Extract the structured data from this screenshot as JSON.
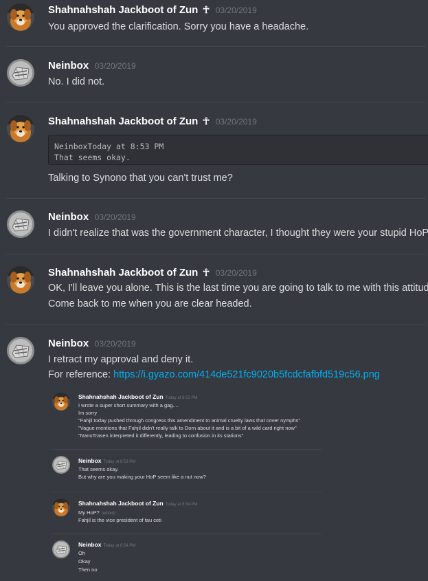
{
  "messages": [
    {
      "author": "Shahnahshah Jackboot of Zun",
      "badge": "☥",
      "timestamp": "03/20/2019",
      "lines": [
        "You approved the clarification. Sorry you have a headache."
      ]
    },
    {
      "author": "Neinbox",
      "timestamp": "03/20/2019",
      "lines": [
        "No. I did not."
      ]
    },
    {
      "author": "Shahnahshah Jackboot of Zun",
      "badge": "☥",
      "timestamp": "03/20/2019",
      "code_lines": [
        "NeinboxToday at 8:53 PM",
        "That seems okay."
      ],
      "lines": [
        "Talking to Synono that you can't trust me?"
      ]
    },
    {
      "author": "Neinbox",
      "timestamp": "03/20/2019",
      "lines": [
        "I didn't realize that was the government character, I thought they were your stupid HoP"
      ]
    },
    {
      "author": "Shahnahshah Jackboot of Zun",
      "badge": "☥",
      "timestamp": "03/20/2019",
      "lines": [
        "OK, I'll leave you alone. This is the last time you are going to talk to me with this attitude.",
        "Come back to me when you are clear headed."
      ]
    },
    {
      "author": "Neinbox",
      "timestamp": "03/20/2019",
      "lines": [
        "I retract my approval and deny it."
      ],
      "reference_label": "For reference: ",
      "reference_link": "https://i.gyazo.com/414de521fc9020b5fcdcfafbfd519c56.png"
    }
  ],
  "embedded_screenshot": {
    "messages": [
      {
        "author": "Shahnahshah Jackboot of Zun",
        "timestamp": "Today at 8:53 PM",
        "lines": [
          "I wrote a super short summary with a gag....",
          "Im sorry",
          "\"Fahjil today pushed through congress this amendment to animal cruelty laws that cover nymphs\"",
          "\"Vague mentions that Fahjil didn't really talk to Dorn about it and is a bit of a wild  card right now\"",
          "\"NanoTrasen interpreted it differently, leading to confusion in its stations\""
        ]
      },
      {
        "author": "Neinbox",
        "timestamp": "Today at 8:53 PM",
        "lines": [
          "That seems okay.",
          "But why are you making your HoP seem like a nut now?"
        ]
      },
      {
        "author": "Shahnahshah Jackboot of Zun",
        "timestamp": "Today at 8:54 PM",
        "lines": [
          "My HoP?",
          "Fahjil is the vice president of tau ceti"
        ],
        "edited_label": "(edited)"
      },
      {
        "author": "Neinbox",
        "timestamp": "Today at 8:54 PM",
        "lines": [
          "Oh",
          "Okay",
          "Then no"
        ]
      }
    ]
  },
  "colors": {
    "background": "#36393f",
    "author": "#ffffff",
    "timestamp": "#72767d",
    "text": "#dcddde",
    "link": "#00b0f4"
  },
  "icons": {
    "dog_avatar": "dog-avatar-icon",
    "neinbox_avatar": "neinbox-avatar-icon"
  }
}
